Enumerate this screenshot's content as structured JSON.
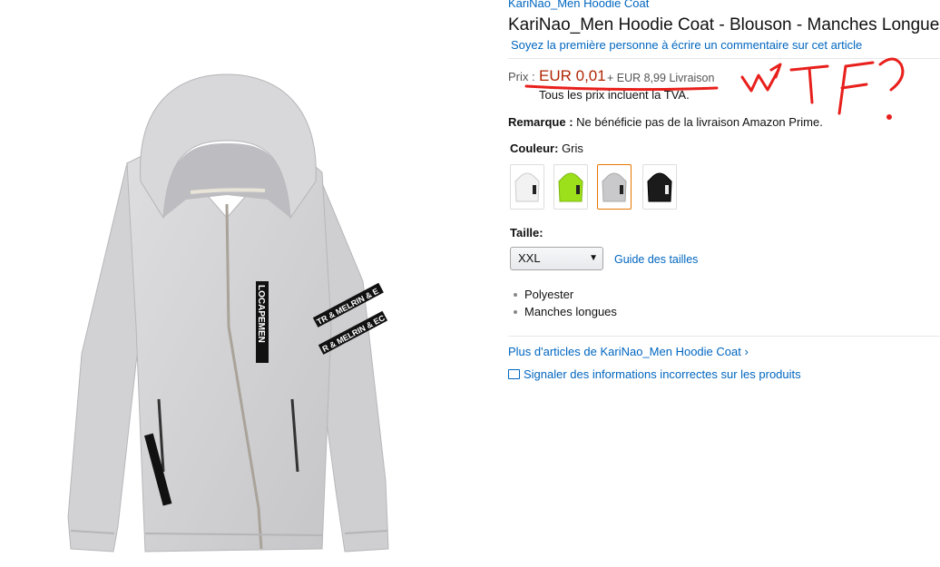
{
  "product": {
    "brand": "KariNao_Men Hoodie Coat",
    "title": "KariNao_Men Hoodie Coat - Blouson - Manches Longues",
    "review_prompt": "Soyez la première personne à écrire un commentaire sur cet article"
  },
  "price": {
    "label": "Prix :",
    "value": "EUR 0,01",
    "shipping": "+ EUR 8,99 Livraison",
    "vat_note": "Tous les prix incluent la TVA."
  },
  "remark": {
    "label": "Remarque :",
    "text": " Ne bénéficie pas de la livraison Amazon Prime."
  },
  "color": {
    "label": "Couleur:",
    "selected": " Gris",
    "swatches": [
      {
        "name": "white",
        "color": "#f2f2f2"
      },
      {
        "name": "lime",
        "color": "#9be01a"
      },
      {
        "name": "grey",
        "color": "#c9c9cb"
      },
      {
        "name": "black",
        "color": "#1b1b1b"
      }
    ]
  },
  "size": {
    "label": "Taille:",
    "selected": "XXL",
    "guide_link": "Guide des tailles"
  },
  "features": [
    "Polyester",
    "Manches longues"
  ],
  "links": {
    "more": "Plus d'articles de KariNao_Men Hoodie Coat ›",
    "report": "Signaler des informations incorrectes sur les produits"
  },
  "annotation": {
    "text": "WTF?",
    "color": "#e8201c"
  },
  "jacket": {
    "print_text_1": "LOCAPEMEN",
    "print_text_2": "TR & MELRIN & E",
    "print_text_3": "R & MELRIN & EC"
  },
  "colors": {
    "link": "#0066c0",
    "price": "#b12704"
  }
}
